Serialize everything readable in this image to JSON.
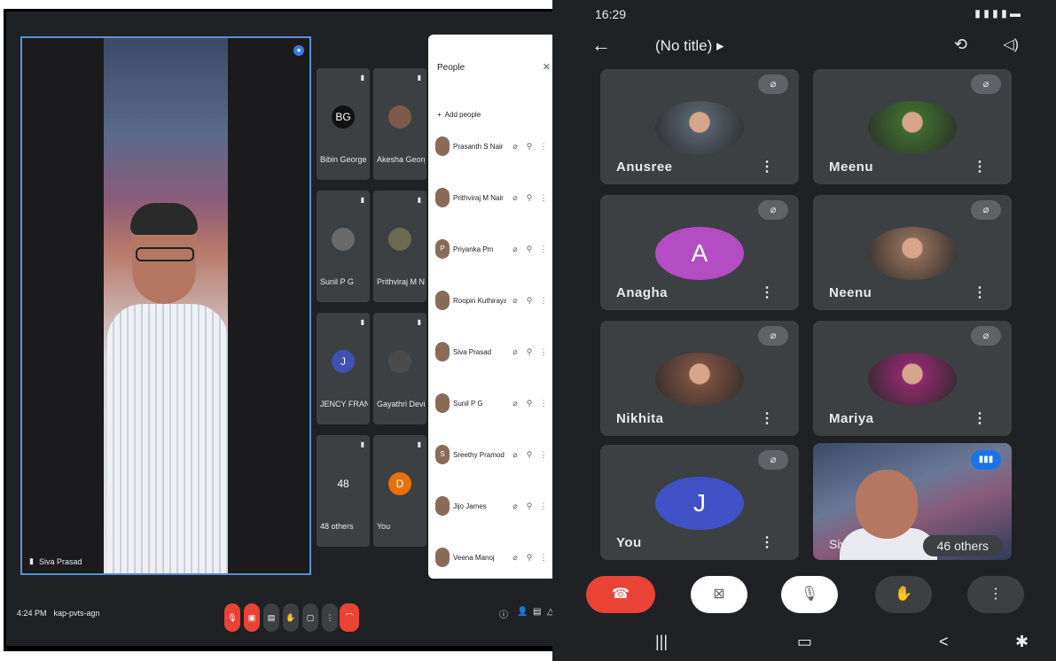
{
  "desktop": {
    "main_speaker": "Siva Prasad",
    "tiles": [
      {
        "name": "Bibin George",
        "avatar": "BG",
        "color": "#111111"
      },
      {
        "name": "Akesha George",
        "avatar": "",
        "color": "#7a5a48"
      },
      {
        "name": "Sunil P G",
        "avatar": "",
        "color": "#6a6a6a"
      },
      {
        "name": "Prithviraj M Nair",
        "avatar": "",
        "color": "#6a6a50"
      },
      {
        "name": "JENCY FRANCIS",
        "avatar": "J",
        "color": "#3f51b5"
      },
      {
        "name": "Gayathri Devi",
        "avatar": "",
        "color": "#4a4a4a"
      },
      {
        "name": "48 others",
        "avatar": "48",
        "color": "#3c4043"
      },
      {
        "name": "You",
        "avatar": "D",
        "color": "#e8710a"
      }
    ],
    "people_panel": {
      "title": "People",
      "add_people": "Add people",
      "rows": [
        {
          "name": "Prasanth S Nair",
          "avatar": ""
        },
        {
          "name": "Prithviraj M Nair",
          "avatar": ""
        },
        {
          "name": "Priyanka Pm",
          "avatar": "P"
        },
        {
          "name": "Roopin Kuthirayakkal",
          "avatar": ""
        },
        {
          "name": "Siva Prasad",
          "avatar": ""
        },
        {
          "name": "Sunil P G",
          "avatar": ""
        },
        {
          "name": "Sreethy Pramod",
          "avatar": "S"
        },
        {
          "name": "Jijo James",
          "avatar": ""
        },
        {
          "name": "Veena Manoj",
          "avatar": ""
        }
      ]
    },
    "time": "4:24 PM",
    "meeting_code": "kap-pvts-agn"
  },
  "phone": {
    "clock": "16:29",
    "title": "(No title)",
    "participants": [
      {
        "name": "Anusree",
        "letter": "",
        "color": "#55606a"
      },
      {
        "name": "Meenu",
        "letter": "",
        "color": "#3e6b2e"
      },
      {
        "name": "Anagha",
        "letter": "A",
        "color": "#b44cc4"
      },
      {
        "name": "Neenu",
        "letter": "",
        "color": "#8a6a58"
      },
      {
        "name": "Nikhita",
        "letter": "",
        "color": "#7a5040"
      },
      {
        "name": "Mariya",
        "letter": "",
        "color": "#8a2a6a"
      },
      {
        "name": "You",
        "letter": "J",
        "color": "#3f51c5"
      }
    ],
    "speaker_label": "Siva",
    "others_count": "46 others"
  }
}
